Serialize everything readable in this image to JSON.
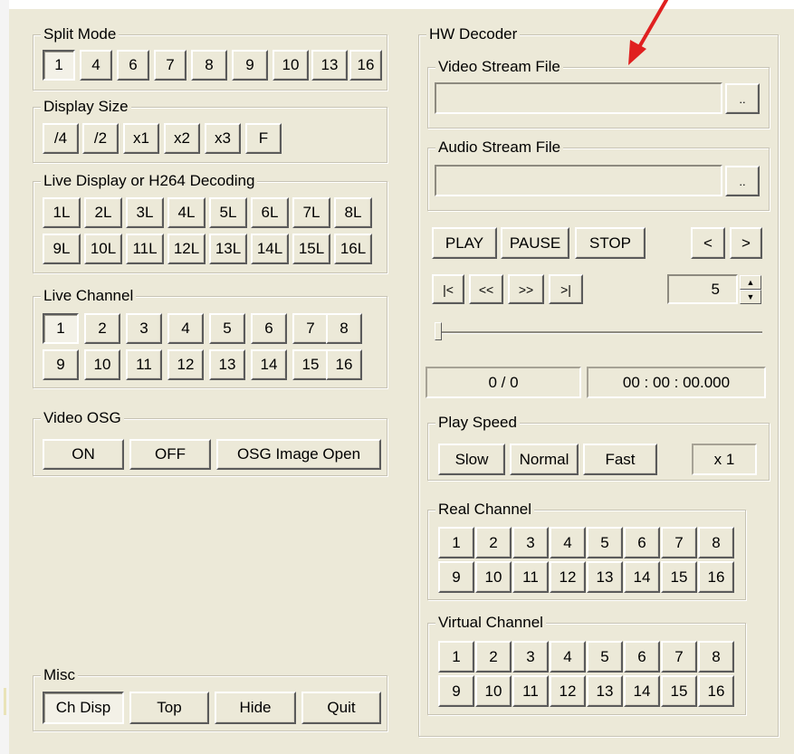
{
  "split_mode": {
    "title": "Split Mode",
    "buttons": [
      "1",
      "4",
      "6",
      "7",
      "8",
      "9",
      "10",
      "13",
      "16"
    ]
  },
  "display_size": {
    "title": "Display Size",
    "buttons": [
      "/4",
      "/2",
      "x1",
      "x2",
      "x3",
      "F"
    ]
  },
  "live_display": {
    "title": "Live Display or H264 Decoding",
    "row1": [
      "1L",
      "2L",
      "3L",
      "4L",
      "5L",
      "6L",
      "7L",
      "8L"
    ],
    "row2": [
      "9L",
      "10L",
      "11L",
      "12L",
      "13L",
      "14L",
      "15L",
      "16L"
    ]
  },
  "live_channel": {
    "title": "Live Channel",
    "row1": [
      "1",
      "2",
      "3",
      "4",
      "5",
      "6",
      "7",
      "8"
    ],
    "row2": [
      "9",
      "10",
      "11",
      "12",
      "13",
      "14",
      "15",
      "16"
    ]
  },
  "video_osg": {
    "title": "Video OSG",
    "on": "ON",
    "off": "OFF",
    "open": "OSG Image Open"
  },
  "misc": {
    "title": "Misc",
    "ch_disp": "Ch Disp",
    "top": "Top",
    "hide": "Hide",
    "quit": "Quit"
  },
  "hw_decoder": {
    "title": "HW Decoder",
    "video_stream": {
      "title": "Video Stream File",
      "value": "",
      "browse": ".."
    },
    "audio_stream": {
      "title": "Audio Stream File",
      "value": "",
      "browse": ".."
    },
    "play": "PLAY",
    "pause": "PAUSE",
    "stop": "STOP",
    "prev": "<",
    "next": ">",
    "first": "|<",
    "rewind": "<<",
    "forward": ">>",
    "last": ">|",
    "step_value": "5",
    "spin_up": "▲",
    "spin_down": "▼",
    "seek_position": 0,
    "frame_counter": "0 / 0",
    "timecode": "00 : 00 : 00.000",
    "play_speed": {
      "title": "Play Speed",
      "slow": "Slow",
      "normal": "Normal",
      "fast": "Fast",
      "rate": "x 1"
    },
    "real_channel": {
      "title": "Real Channel",
      "row1": [
        "1",
        "2",
        "3",
        "4",
        "5",
        "6",
        "7",
        "8"
      ],
      "row2": [
        "9",
        "10",
        "11",
        "12",
        "13",
        "14",
        "15",
        "16"
      ]
    },
    "virtual_channel": {
      "title": "Virtual Channel",
      "row1": [
        "1",
        "2",
        "3",
        "4",
        "5",
        "6",
        "7",
        "8"
      ],
      "row2": [
        "9",
        "10",
        "11",
        "12",
        "13",
        "14",
        "15",
        "16"
      ]
    }
  },
  "annotation": {
    "arrow_color": "#e02020"
  }
}
